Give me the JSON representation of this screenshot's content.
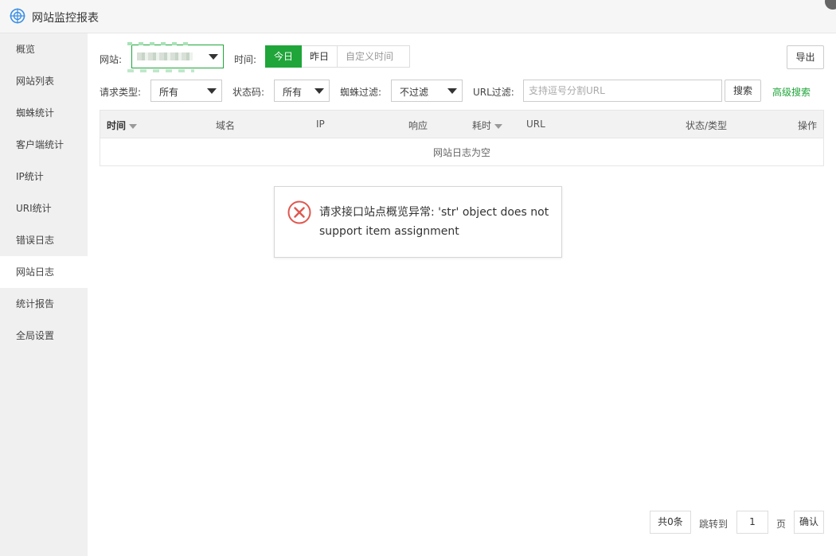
{
  "window": {
    "title": "网站监控报表"
  },
  "sidebar": {
    "items": [
      {
        "label": "概览"
      },
      {
        "label": "网站列表"
      },
      {
        "label": "蜘蛛统计"
      },
      {
        "label": "客户端统计"
      },
      {
        "label": "IP统计"
      },
      {
        "label": "URI统计"
      },
      {
        "label": "错误日志"
      },
      {
        "label": "网站日志"
      },
      {
        "label": "统计报告"
      },
      {
        "label": "全局设置"
      }
    ],
    "active_index": 7
  },
  "filters": {
    "site_label": "网站:",
    "time_label": "时间:",
    "time_options": [
      "今日",
      "昨日"
    ],
    "custom_time_placeholder": "自定义时间",
    "export_label": "导出",
    "request_type_label": "请求类型:",
    "request_type_value": "所有",
    "status_code_label": "状态码:",
    "status_code_value": "所有",
    "spider_filter_label": "蜘蛛过滤:",
    "spider_filter_value": "不过滤",
    "url_filter_label": "URL过滤:",
    "url_filter_placeholder": "支持逗号分割URL",
    "search_label": "搜索",
    "advanced_search_label": "高级搜索"
  },
  "table": {
    "columns": [
      "时间",
      "域名",
      "IP",
      "响应",
      "耗时",
      "URL",
      "状态/类型",
      "操作"
    ],
    "empty_text": "网站日志为空"
  },
  "toast": {
    "message": "请求接口站点概览异常: 'str' object does not support item assignment"
  },
  "pagination": {
    "total": "共0条",
    "jump_label": "跳转到",
    "page_value": "1",
    "page_unit": "页",
    "confirm_label": "确认"
  },
  "colors": {
    "accent": "#20a53a",
    "error": "#e0574f",
    "sidebar_bg": "#f0f0f0"
  }
}
